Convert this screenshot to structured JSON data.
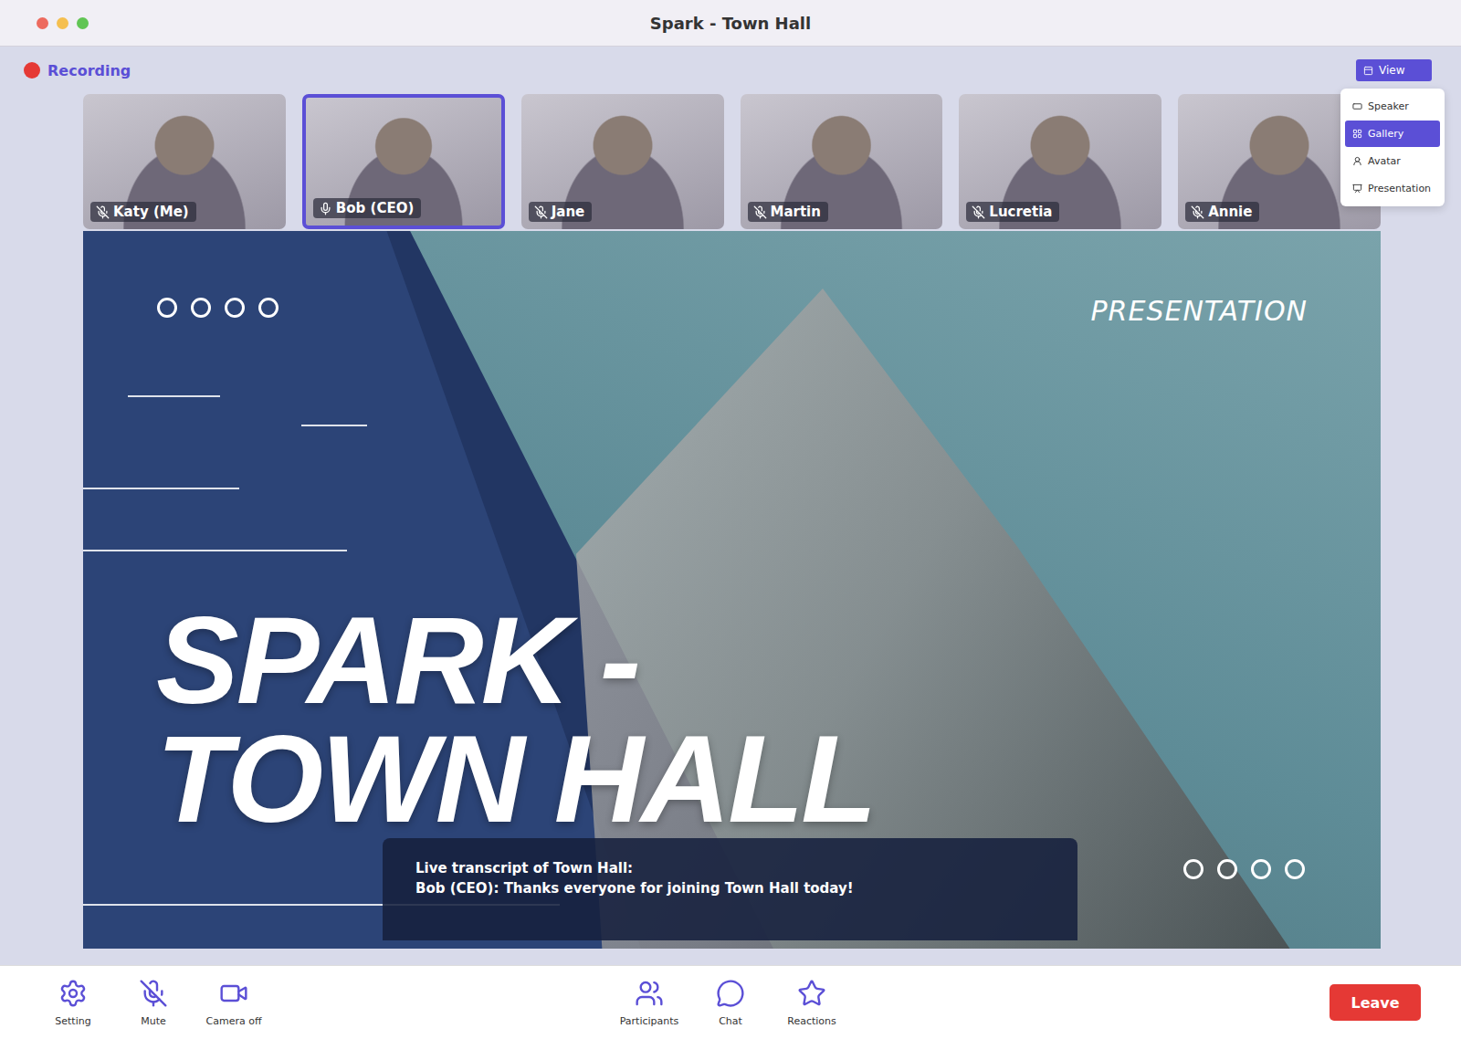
{
  "window": {
    "title": "Spark - Town Hall"
  },
  "recording": {
    "label": "Recording",
    "on": true
  },
  "view_menu": {
    "button": "View",
    "expanded": true,
    "items": [
      {
        "label": "Speaker",
        "selected": false
      },
      {
        "label": "Gallery",
        "selected": true
      },
      {
        "label": "Avatar",
        "selected": false
      },
      {
        "label": "Presentation",
        "selected": false
      }
    ]
  },
  "participants": [
    {
      "name": "Katy (Me)",
      "muted": true,
      "selected": false
    },
    {
      "name": "Bob (CEO)",
      "muted": false,
      "selected": true
    },
    {
      "name": "Jane",
      "muted": true,
      "selected": false
    },
    {
      "name": "Martin",
      "muted": true,
      "selected": false
    },
    {
      "name": "Lucretia",
      "muted": true,
      "selected": false
    },
    {
      "name": "Annie",
      "muted": true,
      "selected": false
    }
  ],
  "slide": {
    "tag": "PRESENTATION",
    "title_lines": [
      "SPARK -",
      "TOWN HALL"
    ]
  },
  "transcript": {
    "heading": "Live transcript of Town Hall:",
    "lines": [
      "Bob (CEO): Thanks everyone for joining Town Hall today!"
    ]
  },
  "toolbar": {
    "left": [
      {
        "label": "Setting"
      },
      {
        "label": "Mute"
      },
      {
        "label": "Camera off"
      }
    ],
    "center": [
      {
        "label": "Participants"
      },
      {
        "label": "Chat"
      },
      {
        "label": "Reactions"
      }
    ],
    "leave": "Leave"
  }
}
